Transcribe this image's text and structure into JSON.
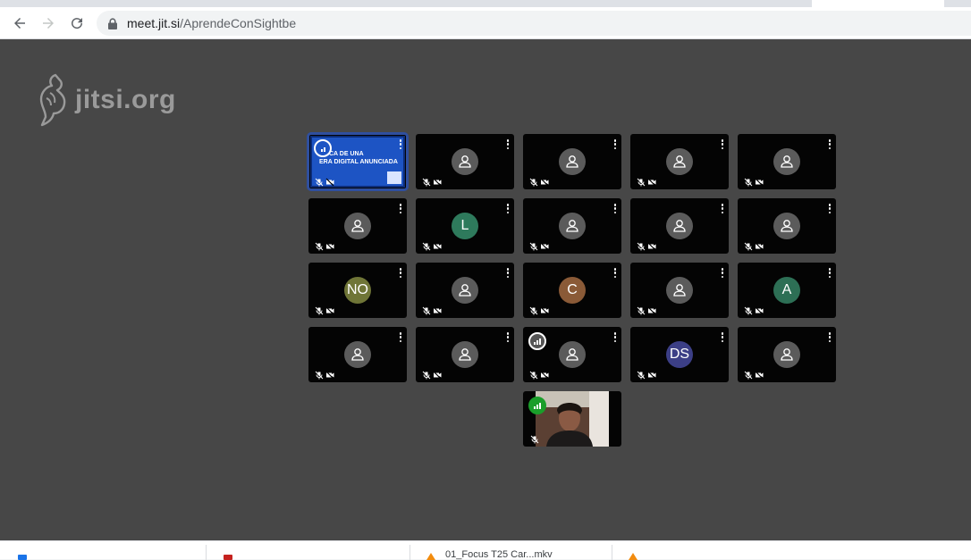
{
  "browser": {
    "url_host": "meet.jit.si",
    "url_path": "/AprendeConSightbe",
    "back_label": "Back",
    "forward_label": "Forward",
    "reload_label": "Reload"
  },
  "brand": {
    "name": "jitsi.org"
  },
  "presentation": {
    "title_line1": "NICA DE UNA",
    "title_line2": "ERA DIGITAL ANUNCIADA"
  },
  "tiles": [
    {
      "type": "presentation"
    },
    {
      "type": "avatar",
      "initials": ""
    },
    {
      "type": "avatar",
      "initials": ""
    },
    {
      "type": "avatar",
      "initials": ""
    },
    {
      "type": "avatar",
      "initials": ""
    },
    {
      "type": "avatar",
      "initials": ""
    },
    {
      "type": "avatar",
      "initials": "L",
      "color": "#2e7a5c"
    },
    {
      "type": "avatar",
      "initials": ""
    },
    {
      "type": "avatar",
      "initials": ""
    },
    {
      "type": "avatar",
      "initials": ""
    },
    {
      "type": "avatar",
      "initials": "NO",
      "color": "#6f7537"
    },
    {
      "type": "avatar",
      "initials": ""
    },
    {
      "type": "avatar",
      "initials": "C",
      "color": "#8a5a37"
    },
    {
      "type": "avatar",
      "initials": ""
    },
    {
      "type": "avatar",
      "initials": "A",
      "color": "#2d6f55"
    },
    {
      "type": "avatar",
      "initials": ""
    },
    {
      "type": "avatar",
      "initials": ""
    },
    {
      "type": "avatar",
      "initials": "",
      "connection": "gray"
    },
    {
      "type": "avatar",
      "initials": "DS",
      "color": "#3c3f86"
    },
    {
      "type": "avatar",
      "initials": ""
    },
    {
      "type": "camera",
      "connection": "green"
    }
  ],
  "downloads": [
    {
      "name": "",
      "icon": "blue-doc-icon"
    },
    {
      "name": "",
      "icon": "red-doc-icon"
    },
    {
      "name": "01_Focus T25 Car...mkv",
      "icon": "vlc-icon"
    },
    {
      "name": "",
      "icon": "vlc-icon"
    }
  ]
}
